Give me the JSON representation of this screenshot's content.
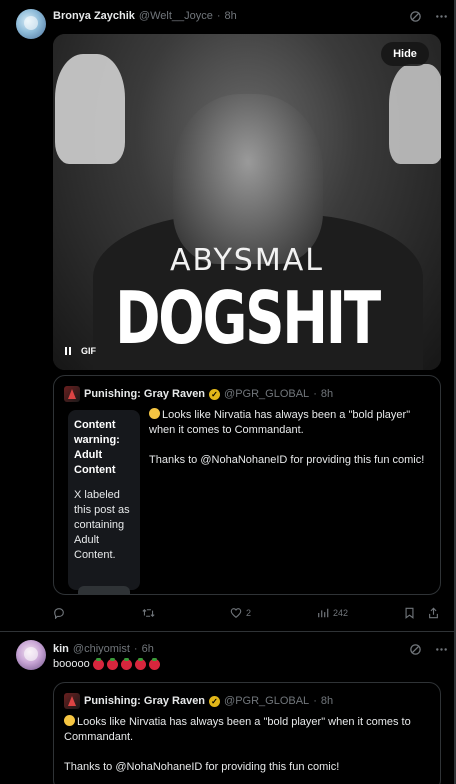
{
  "tweet1": {
    "name": "Bronya Zaychik",
    "handle": "@Welt__Joyce",
    "dot": "·",
    "time": "8h",
    "media": {
      "hide_label": "Hide",
      "gif_label": "GIF",
      "line1": "ABYSMAL",
      "line2": "DOGSHIT"
    },
    "quote": {
      "name": "Punishing: Gray Raven",
      "handle": "@PGR_GLOBAL",
      "dot": "·",
      "time": "8h",
      "cw_title": "Content warning: Adult Content",
      "cw_text": "X labeled this post as containing Adult Content.",
      "text_p1": "Looks like Nirvatia has always been a \"bold player\" when it comes to Commandant.",
      "text_p2": "Thanks to @NohaNohaneID for providing this fun comic!"
    },
    "actions": {
      "likes": "2",
      "views": "242"
    }
  },
  "tweet2": {
    "name": "kin",
    "handle": "@chiyomist",
    "dot": "·",
    "time": "6h",
    "text": "booooo",
    "quote": {
      "name": "Punishing: Gray Raven",
      "handle": "@PGR_GLOBAL",
      "dot": "·",
      "time": "8h",
      "text_p1": "Looks like Nirvatia has always been a \"bold player\" when it comes to Commandant.",
      "text_p2": "Thanks to @NohaNohaneID for providing this fun comic!"
    }
  },
  "colors": {
    "background": "#000000",
    "muted": "#71767b",
    "border": "#2f3336",
    "verified": "#e2b719"
  }
}
